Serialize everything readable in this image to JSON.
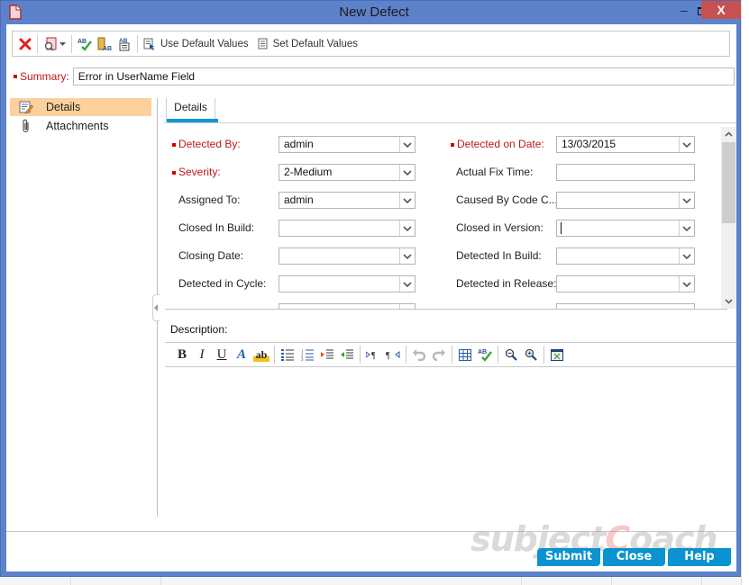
{
  "window": {
    "title": "New Defect",
    "minimize_glyph": "–",
    "close_glyph": "X",
    "frame_color": "#5d82cc",
    "close_color": "#c75050"
  },
  "toolbar": {
    "items": [
      {
        "icon": "delete-icon",
        "label": ""
      },
      {
        "icon": "find-similar-defects-icon",
        "label": ""
      },
      {
        "icon": "spell-check-icon",
        "label": ""
      },
      {
        "icon": "thesaurus-icon",
        "label": ""
      },
      {
        "icon": "spelling-options-icon",
        "label": ""
      }
    ],
    "use_default_values": "Use Default Values",
    "set_default_values": "Set Default Values"
  },
  "summary": {
    "label": "Summary:",
    "value": "Error in UserName Field"
  },
  "sidebar": {
    "items": [
      {
        "label": "Details",
        "icon": "details-icon",
        "active": true
      },
      {
        "label": "Attachments",
        "icon": "paperclip-icon",
        "active": false
      }
    ]
  },
  "tabs": [
    {
      "label": "Details",
      "active": true
    }
  ],
  "fields": {
    "left": [
      {
        "label": "Detected By:",
        "required": true,
        "value": "admin",
        "type": "combo"
      },
      {
        "label": "Severity:",
        "required": true,
        "value": "2-Medium",
        "type": "combo"
      },
      {
        "label": "Assigned To:",
        "required": false,
        "value": "admin",
        "type": "combo"
      },
      {
        "label": "Closed In Build:",
        "required": false,
        "value": "",
        "type": "combo"
      },
      {
        "label": "Closing Date:",
        "required": false,
        "value": "",
        "type": "combo"
      },
      {
        "label": "Detected in Cycle:",
        "required": false,
        "value": "",
        "type": "combo"
      }
    ],
    "right": [
      {
        "label": "Detected on Date:",
        "required": true,
        "value": "13/03/2015",
        "type": "combo"
      },
      {
        "label": "Actual Fix Time:",
        "required": false,
        "value": "",
        "type": "text"
      },
      {
        "label": "Caused By Code C...",
        "required": false,
        "value": "",
        "type": "combo"
      },
      {
        "label": "Closed in Version:",
        "required": false,
        "value": "",
        "type": "combo",
        "focused": true
      },
      {
        "label": "Detected In Build:",
        "required": false,
        "value": "",
        "type": "combo"
      },
      {
        "label": "Detected in Release:",
        "required": false,
        "value": "",
        "type": "combo"
      }
    ]
  },
  "description": {
    "label": "Description:",
    "toolbar": [
      "bold",
      "italic",
      "underline",
      "font-color",
      "highlight",
      "bullet-list",
      "numbered-list",
      "indent",
      "outdent",
      "ltr",
      "rtl",
      "undo",
      "redo",
      "table",
      "spell-check",
      "zoom-out",
      "zoom-in",
      "fullscreen"
    ],
    "bold_glyph": "B",
    "italic_glyph": "I",
    "underline_glyph": "U",
    "font_color_glyph": "A",
    "highlight_glyph": "ab",
    "value": ""
  },
  "buttons": {
    "submit": "Submit",
    "close": "Close",
    "help": "Help",
    "color": "#0a93d0"
  },
  "watermark": {
    "part1": "subject",
    "part2": "C",
    "part3": "oach"
  }
}
